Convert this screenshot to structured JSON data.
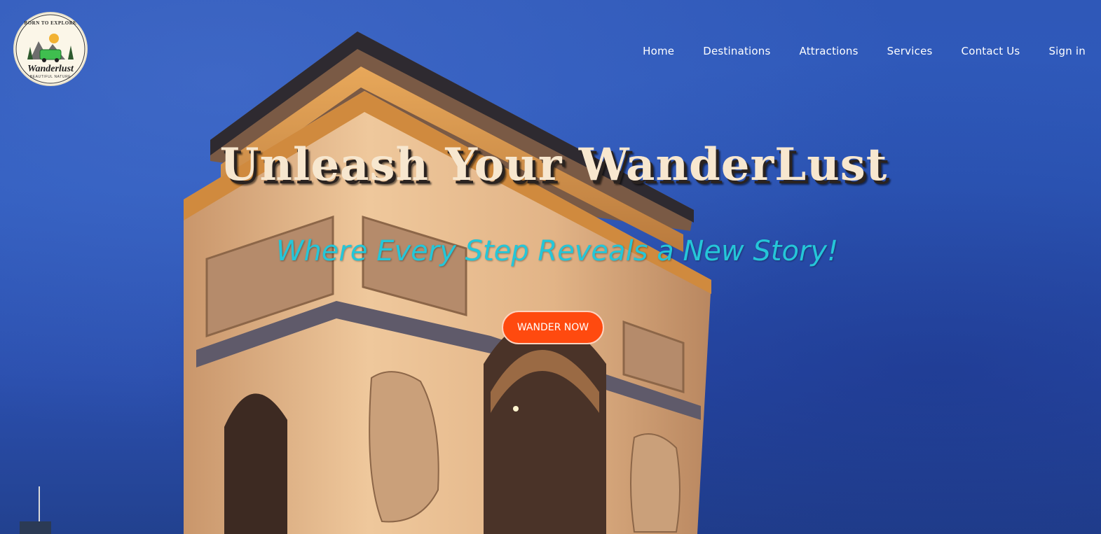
{
  "logo": {
    "top_text": "BORN TO EXPLORE",
    "brand": "Wanderlust",
    "sub_text": "BEAUTIFUL NATURE"
  },
  "nav": {
    "items": [
      "Home",
      "Destinations",
      "Attractions",
      "Services",
      "Contact Us",
      "Sign in"
    ]
  },
  "hero": {
    "headline": "Unleash Your WanderLust",
    "tagline": "Where Every Step Reveals a New Story!",
    "cta_label": "WANDER NOW"
  },
  "colors": {
    "sky": "#2f58b8",
    "headline": "#f7e7cf",
    "tagline": "#25c6d8",
    "cta": "#ff4a0f"
  }
}
